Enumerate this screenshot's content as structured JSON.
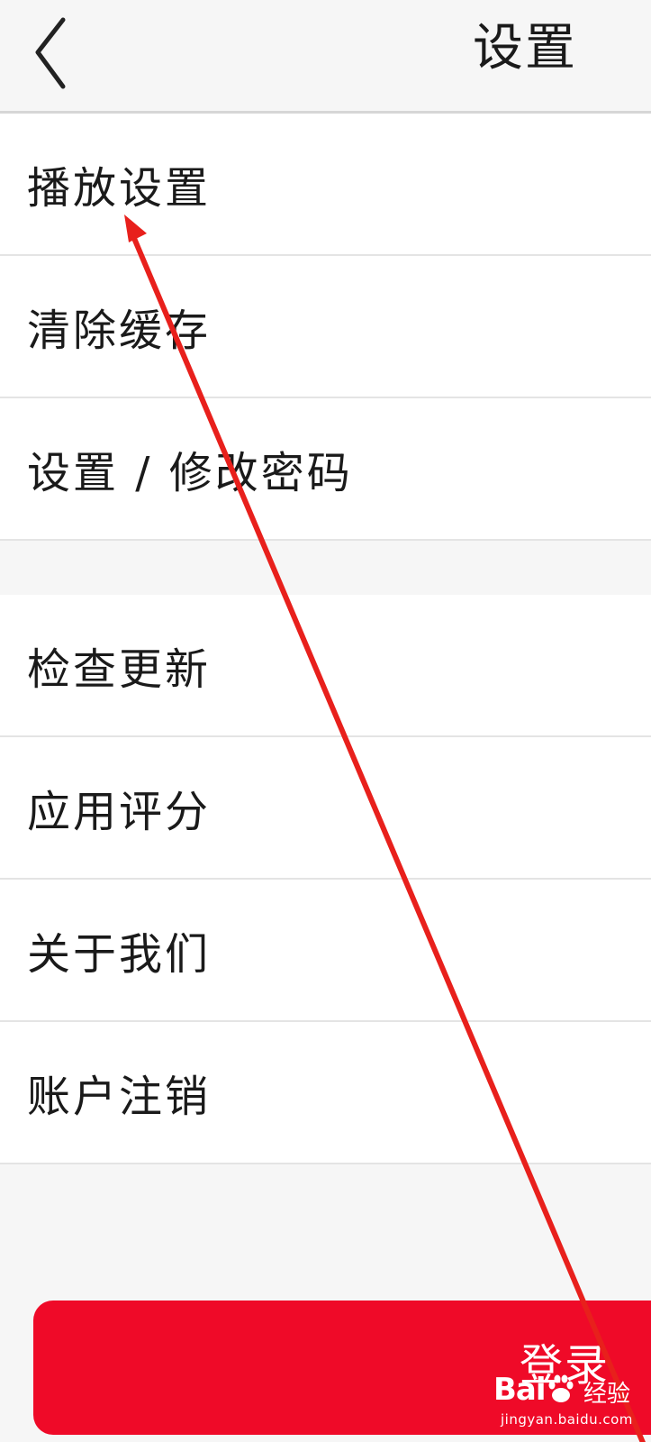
{
  "header": {
    "title": "设置",
    "back_icon": "chevron-left-icon"
  },
  "settings": {
    "group1": [
      {
        "label": "播放设置"
      },
      {
        "label": "清除缓存"
      },
      {
        "label": "设置 / 修改密码"
      }
    ],
    "group2": [
      {
        "label": "检查更新"
      },
      {
        "label": "应用评分"
      },
      {
        "label": "关于我们"
      },
      {
        "label": "账户注销"
      }
    ]
  },
  "login": {
    "label": "登录",
    "color": "#ef0a28"
  },
  "annotation": {
    "color": "#e8201c",
    "icon": "red-arrow-pointing-to-播放设置"
  },
  "watermark": {
    "logo": "Bai",
    "logo_icon": "paw-icon",
    "text": "经验",
    "url": "jingyan.baidu.com"
  }
}
